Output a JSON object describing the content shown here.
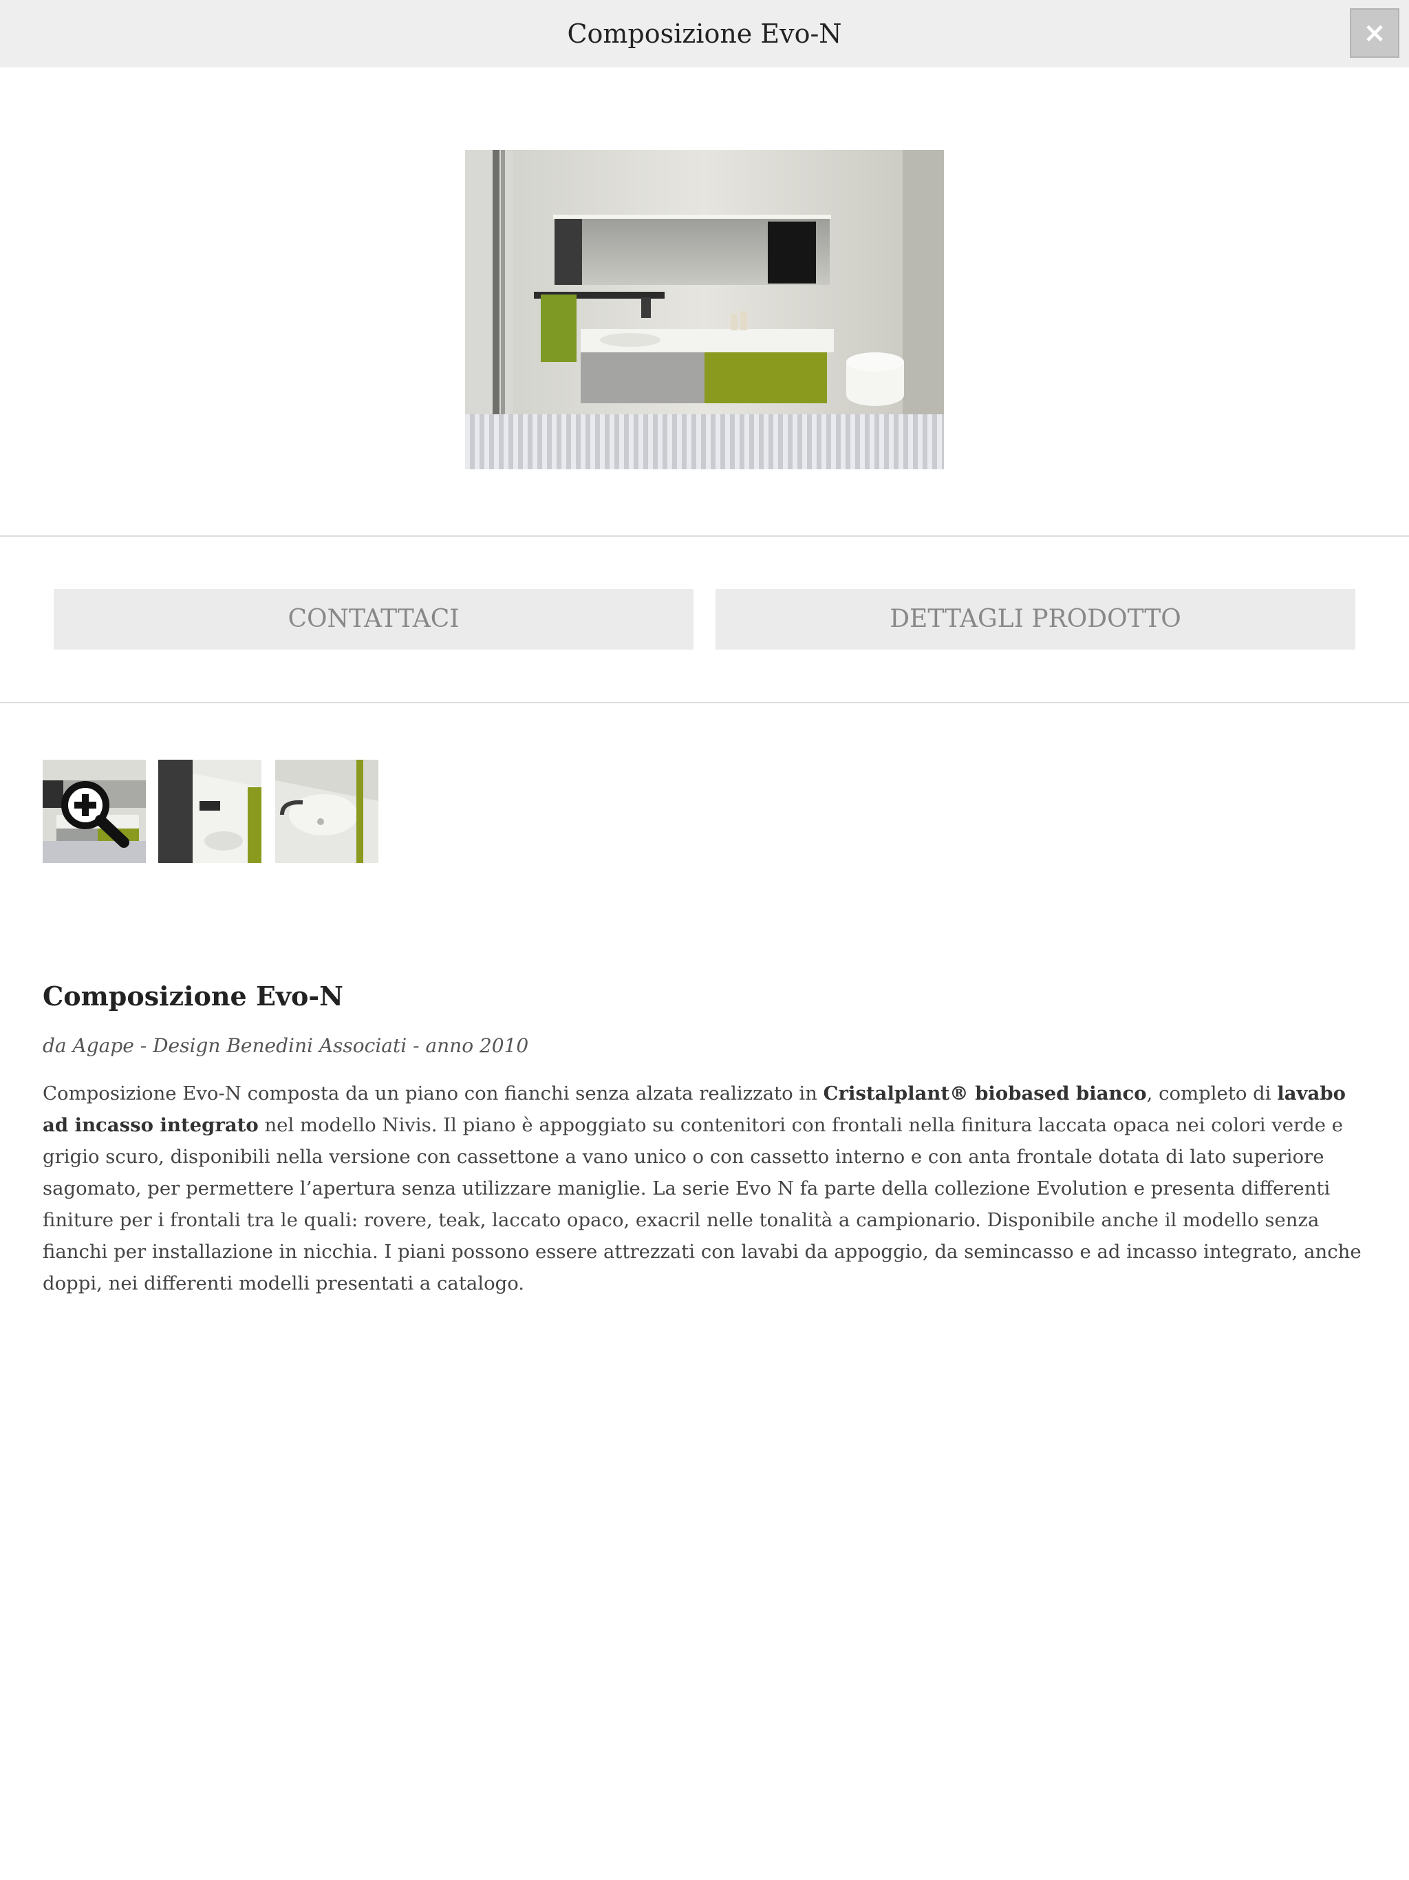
{
  "header": {
    "title": "Composizione Evo-N",
    "close_label": "×"
  },
  "actions": {
    "contact_label": "CONTATTACI",
    "details_label": "DETTAGLI PRODOTTO"
  },
  "gallery": {
    "zoom_icon": "zoom-in-icon",
    "thumbnails": [
      "thumbnail-1",
      "thumbnail-2",
      "thumbnail-3"
    ]
  },
  "product": {
    "title": "Composizione Evo-N",
    "meta": "da Agape - Design Benedini Associati - anno 2010",
    "desc": {
      "p1": "Composizione Evo-N composta da un piano con fianchi senza alzata realizzato in ",
      "b1": "Cristalplant® biobased bianco",
      "p2": ", completo di ",
      "b2": "lavabo ad incasso integrato",
      "p3": " nel modello Nivis. Il piano è appoggiato su contenitori con frontali nella finitura laccata opaca nei colori verde e grigio scuro, disponibili nella versione con cassettone a vano unico o con cassetto interno e con anta frontale dotata di lato superiore sagomato, per permettere l’apertura senza utilizzare maniglie. La serie Evo N fa parte della collezione Evolution e presenta differenti finiture per i frontali tra le quali: rovere, teak, laccato opaco, exacril nelle tonalità a campionario. Disponibile anche il modello senza fianchi per installazione in nicchia. I piani possono essere attrezzati con lavabi da appoggio, da semincasso e ad incasso integrato, anche doppi, nei differenti modelli presentati a catalogo."
    }
  },
  "colors": {
    "topbar": "#eeeeee",
    "button_bg": "#ebebeb",
    "button_text": "#888888",
    "accent_green": "#8a9a1e"
  }
}
